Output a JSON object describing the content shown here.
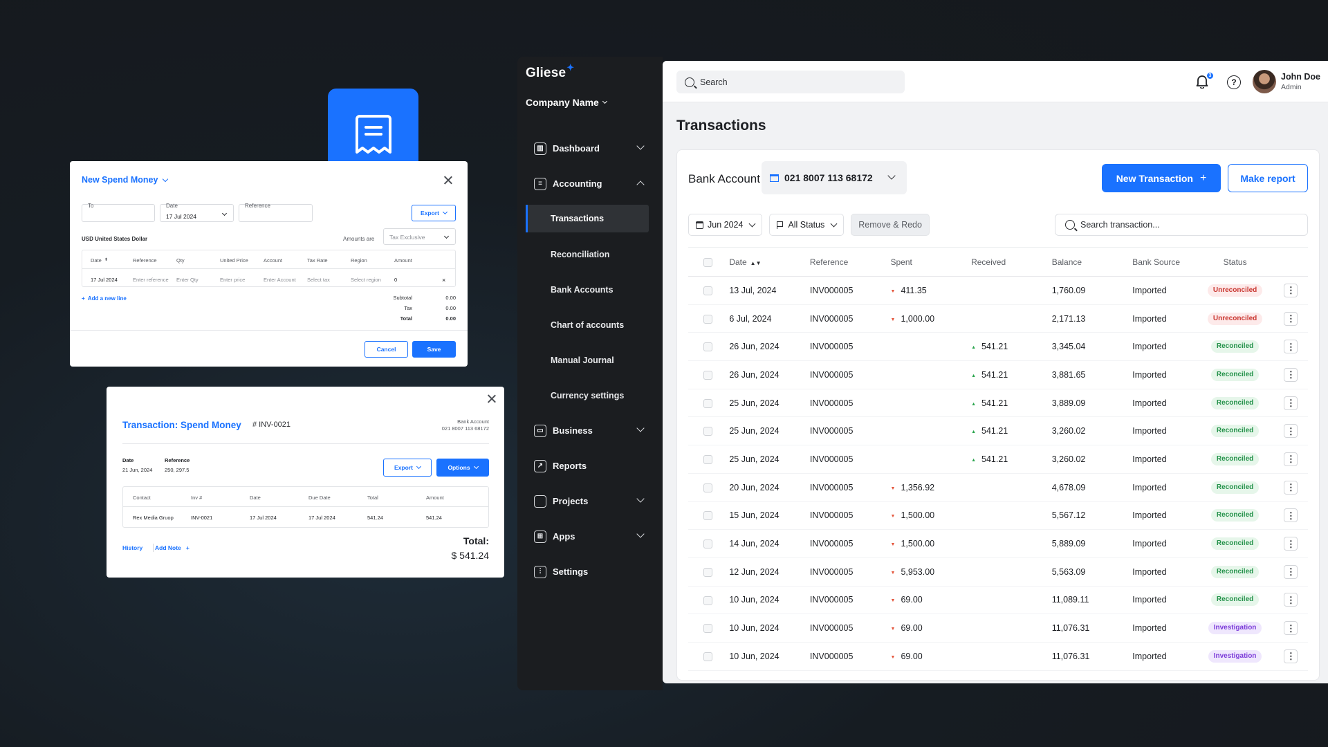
{
  "brand": {
    "name": "Gliese",
    "accent": "#1a72ff"
  },
  "sidebar": {
    "company": "Company Name",
    "items": [
      {
        "label": "Dashboard",
        "icon": "chart-icon"
      },
      {
        "label": "Accounting",
        "icon": "receipt-icon"
      },
      {
        "label": "Business",
        "icon": "briefcase-icon"
      },
      {
        "label": "Reports",
        "icon": "trend-icon"
      },
      {
        "label": "Projects",
        "icon": "folder-icon"
      },
      {
        "label": "Apps",
        "icon": "grid-icon"
      },
      {
        "label": "Settings",
        "icon": "sliders-icon"
      }
    ],
    "accounting_sub": [
      "Transactions",
      "Reconciliation",
      "Bank Accounts",
      "Chart of accounts",
      "Manual Journal",
      "Currency settings"
    ]
  },
  "topbar": {
    "search_placeholder": "Search",
    "notifications": "3",
    "user_name": "John Doe",
    "user_role": "Admin"
  },
  "page": {
    "title": "Transactions",
    "bank_label": "Bank Account",
    "bank_account": "021 8007 113 68172",
    "new_transaction": "New Transaction",
    "make_report": "Make report",
    "filter_month": "Jun 2024",
    "filter_status": "All Status",
    "remove_redo": "Remove & Redo",
    "search_placeholder": "Search transaction..."
  },
  "table": {
    "columns": [
      "Date",
      "Reference",
      "Spent",
      "Received",
      "Balance",
      "Bank  Source",
      "Status"
    ],
    "rows": [
      {
        "date": "13 Jul, 2024",
        "ref": "INV000005",
        "spent": "411.35",
        "received": "",
        "balance": "1,760.09",
        "source": "Imported",
        "status": "Unreconciled"
      },
      {
        "date": "6 Jul, 2024",
        "ref": "INV000005",
        "spent": "1,000.00",
        "received": "",
        "balance": "2,171.13",
        "source": "Imported",
        "status": "Unreconciled"
      },
      {
        "date": "26 Jun, 2024",
        "ref": "INV000005",
        "spent": "",
        "received": "541.21",
        "balance": "3,345.04",
        "source": "Imported",
        "status": "Reconciled"
      },
      {
        "date": "26 Jun, 2024",
        "ref": "INV000005",
        "spent": "",
        "received": "541.21",
        "balance": "3,881.65",
        "source": "Imported",
        "status": "Reconciled"
      },
      {
        "date": "25 Jun, 2024",
        "ref": "INV000005",
        "spent": "",
        "received": "541.21",
        "balance": "3,889.09",
        "source": "Imported",
        "status": "Reconciled"
      },
      {
        "date": "25 Jun, 2024",
        "ref": "INV000005",
        "spent": "",
        "received": "541.21",
        "balance": "3,260.02",
        "source": "Imported",
        "status": "Reconciled"
      },
      {
        "date": "25 Jun, 2024",
        "ref": "INV000005",
        "spent": "",
        "received": "541.21",
        "balance": "3,260.02",
        "source": "Imported",
        "status": "Reconciled"
      },
      {
        "date": "20 Jun, 2024",
        "ref": "INV000005",
        "spent": "1,356.92",
        "received": "",
        "balance": "4,678.09",
        "source": "Imported",
        "status": "Reconciled"
      },
      {
        "date": "15 Jun, 2024",
        "ref": "INV000005",
        "spent": "1,500.00",
        "received": "",
        "balance": "5,567.12",
        "source": "Imported",
        "status": "Reconciled"
      },
      {
        "date": "14 Jun, 2024",
        "ref": "INV000005",
        "spent": "1,500.00",
        "received": "",
        "balance": "5,889.09",
        "source": "Imported",
        "status": "Reconciled"
      },
      {
        "date": "12 Jun, 2024",
        "ref": "INV000005",
        "spent": "5,953.00",
        "received": "",
        "balance": "5,563.09",
        "source": "Imported",
        "status": "Reconciled"
      },
      {
        "date": "10 Jun, 2024",
        "ref": "INV000005",
        "spent": "69.00",
        "received": "",
        "balance": "11,089.11",
        "source": "Imported",
        "status": "Reconciled"
      },
      {
        "date": "10 Jun, 2024",
        "ref": "INV000005",
        "spent": "69.00",
        "received": "",
        "balance": "11,076.31",
        "source": "Imported",
        "status": "Investigation"
      },
      {
        "date": "10 Jun, 2024",
        "ref": "INV000005",
        "spent": "69.00",
        "received": "",
        "balance": "11,076.31",
        "source": "Imported",
        "status": "Investigation"
      }
    ]
  },
  "spend_dialog": {
    "title": "New Spend Money",
    "to_label": "To",
    "date_label": "Date",
    "date_value": "17 Jul 2024",
    "reference_label": "Reference",
    "export": "Export",
    "currency": "USD United States Dollar",
    "amounts_are": "Amounts are",
    "tax_mode": "Tax Exclusive",
    "columns": [
      "Date",
      "Reference",
      "Qty",
      "United Price",
      "Account",
      "Tax Rate",
      "Region",
      "Amount"
    ],
    "row": {
      "date": "17 Jul 2024",
      "reference": "Enter reference",
      "qty": "Enter Qty",
      "price": "Enter price",
      "account": "Enter Account",
      "tax": "Select tax",
      "region": "Select region",
      "amount": "0"
    },
    "add_line": "Add a new line",
    "subtotal_label": "Subtotal",
    "subtotal": "0.00",
    "tax_label": "Tax",
    "tax": "0.00",
    "total_label": "Total",
    "total": "0.00",
    "cancel": "Cancel",
    "save": "Save"
  },
  "detail_dialog": {
    "title": "Transaction: Spend Money",
    "number": "# INV-0021",
    "bank_label": "Bank Account",
    "bank_account": "021 8007 113 68172",
    "date_label": "Date",
    "date": "21 Jun, 2024",
    "ref_label": "Reference",
    "ref": "250, 297.5",
    "export": "Export",
    "options": "Options",
    "columns": [
      "Contact",
      "Inv #",
      "Date",
      "Due Date",
      "Total",
      "Amount"
    ],
    "row": [
      "Rex Media Gruop",
      "INV-0021",
      "17 Jul 2024",
      "17 Jul 2024",
      "541.24",
      "541.24"
    ],
    "history": "History",
    "add_note": "Add Note",
    "total_label": "Total:",
    "total": "$ 541.24"
  }
}
